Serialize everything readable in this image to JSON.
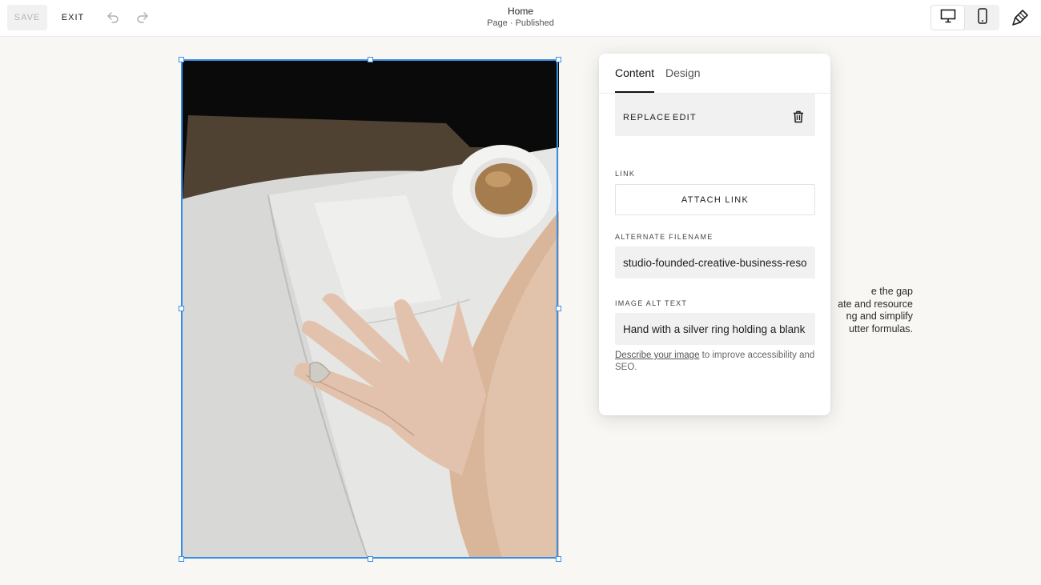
{
  "toolbar": {
    "save_label": "SAVE",
    "exit_label": "EXIT"
  },
  "page": {
    "title": "Home",
    "status": "Page · Published"
  },
  "background_text": {
    "lines": [
      "e the gap",
      "ate and resource",
      "ng and simplify",
      "utter formulas."
    ]
  },
  "panel": {
    "tabs": [
      {
        "label": "Content",
        "active": true
      },
      {
        "label": "Design",
        "active": false
      }
    ],
    "replace_label": "REPLACE",
    "edit_label": "EDIT",
    "link": {
      "label": "LINK",
      "button_label": "ATTACH LINK"
    },
    "filename": {
      "label": "ALTERNATE FILENAME",
      "value": "studio-founded-creative-business-resource"
    },
    "alt_text": {
      "label": "IMAGE ALT TEXT",
      "value": "Hand with a silver ring holding a blank notebook"
    },
    "help": {
      "link_text": "Describe your image",
      "rest_text": " to improve accessibility and SEO."
    }
  },
  "icons": {
    "undo": "undo-icon",
    "redo": "redo-icon",
    "desktop": "desktop-icon",
    "mobile": "mobile-icon",
    "site_styles": "paintbrush-icon",
    "delete": "trash-icon"
  },
  "colors": {
    "selection": "#3a8ee6",
    "canvas_background": "#f8f7f4",
    "field_background": "#f1f1f1"
  }
}
